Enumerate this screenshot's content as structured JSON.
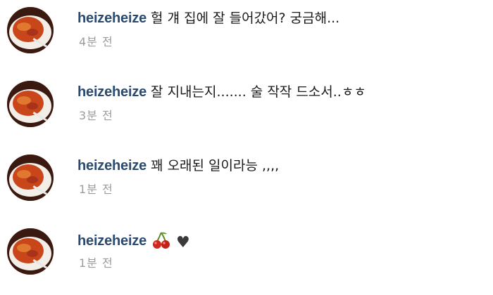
{
  "comments": [
    {
      "username": "heizeheize",
      "text": "헐 걔 집에 잘 들어갔어? 궁금해...",
      "time": "4분 전"
    },
    {
      "username": "heizeheize",
      "text": "잘 지내는지....... 술 작작 드소서..ㅎㅎ",
      "time": "3분 전"
    },
    {
      "username": "heizeheize",
      "text": "꽤 오래된 일이라능 ,,,,",
      "time": "1분 전"
    },
    {
      "username": "heizeheize",
      "text": "",
      "time": "1분 전",
      "emojis": [
        "cherries",
        "black-heart"
      ]
    }
  ],
  "icons": {
    "heart_glyph": "♥"
  },
  "colors": {
    "username": "#2a4a70",
    "timestamp": "#9b9b9b",
    "avatar_food": "#c24a1c"
  }
}
